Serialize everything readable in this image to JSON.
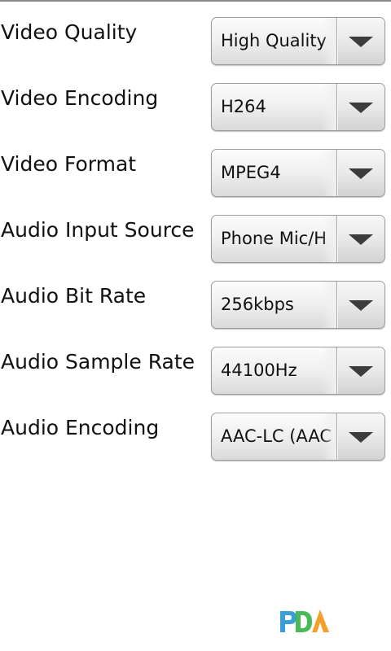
{
  "settings": [
    {
      "label": "Video Quality",
      "value": "High Quality"
    },
    {
      "label": "Video Encoding",
      "value": "H264"
    },
    {
      "label": "Video Format",
      "value": "MPEG4"
    },
    {
      "label": "Audio Input Source",
      "value": "Phone Mic/H"
    },
    {
      "label": "Audio Bit Rate",
      "value": "256kbps"
    },
    {
      "label": "Audio Sample Rate",
      "value": "44100Hz"
    },
    {
      "label": "Audio Encoding",
      "value": "AAC-LC (AAC"
    }
  ],
  "icons": {
    "dropdown": "chevron-down-icon",
    "logo": "pda-logo-icon"
  },
  "colors": {
    "background": "#ffffff",
    "text": "#111111",
    "spinner_border": "#9c9c9c",
    "chevron": "#3c3c3c",
    "logo_blue": "#3b9fd6",
    "logo_green": "#3bb34a",
    "logo_orange": "#f39a1e"
  }
}
